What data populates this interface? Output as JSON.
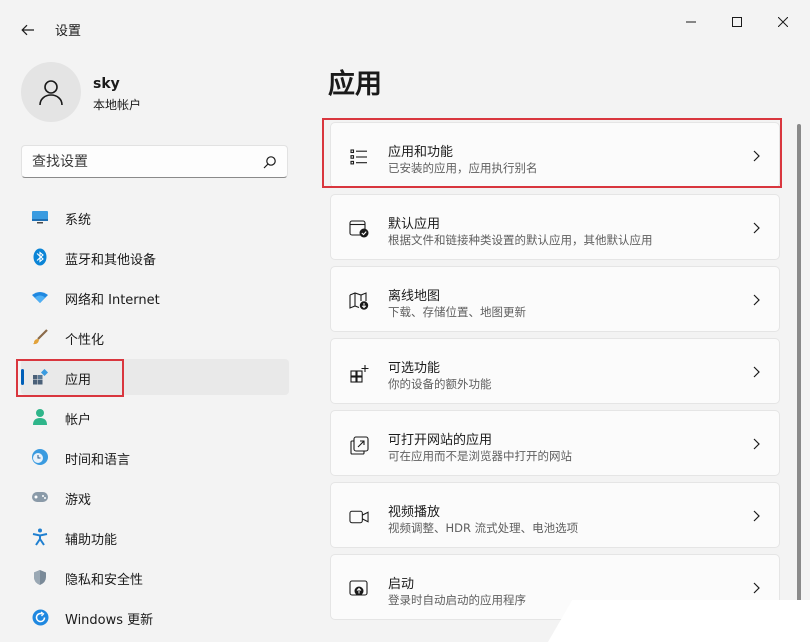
{
  "window": {
    "title": "设置"
  },
  "profile": {
    "name": "sky",
    "account_type": "本地帐户"
  },
  "search": {
    "placeholder": "查找设置"
  },
  "nav": {
    "items": [
      {
        "label": "系统",
        "icon": "monitor-icon"
      },
      {
        "label": "蓝牙和其他设备",
        "icon": "bluetooth-icon"
      },
      {
        "label": "网络和 Internet",
        "icon": "wifi-icon"
      },
      {
        "label": "个性化",
        "icon": "brush-icon"
      },
      {
        "label": "应用",
        "icon": "apps-icon",
        "selected": true
      },
      {
        "label": "帐户",
        "icon": "person-icon"
      },
      {
        "label": "时间和语言",
        "icon": "clock-globe-icon"
      },
      {
        "label": "游戏",
        "icon": "gamepad-icon"
      },
      {
        "label": "辅助功能",
        "icon": "accessibility-icon"
      },
      {
        "label": "隐私和安全性",
        "icon": "shield-icon"
      },
      {
        "label": "Windows 更新",
        "icon": "update-icon"
      }
    ]
  },
  "main": {
    "title": "应用",
    "cards": [
      {
        "title": "应用和功能",
        "subtitle": "已安装的应用，应用执行别名",
        "icon": "list-icon"
      },
      {
        "title": "默认应用",
        "subtitle": "根据文件和链接种类设置的默认应用，其他默认应用",
        "icon": "default-apps-icon"
      },
      {
        "title": "离线地图",
        "subtitle": "下载、存储位置、地图更新",
        "icon": "map-download-icon"
      },
      {
        "title": "可选功能",
        "subtitle": "你的设备的额外功能",
        "icon": "optional-features-icon"
      },
      {
        "title": "可打开网站的应用",
        "subtitle": "可在应用而不是浏览器中打开的网站",
        "icon": "open-web-icon"
      },
      {
        "title": "视频播放",
        "subtitle": "视频调整、HDR 流式处理、电池选项",
        "icon": "video-icon"
      },
      {
        "title": "启动",
        "subtitle": "登录时自动启动的应用程序",
        "icon": "startup-icon"
      }
    ]
  },
  "colors": {
    "accent": "#005fb8",
    "highlight": "#d9363e",
    "background": "#f3f3f3"
  }
}
